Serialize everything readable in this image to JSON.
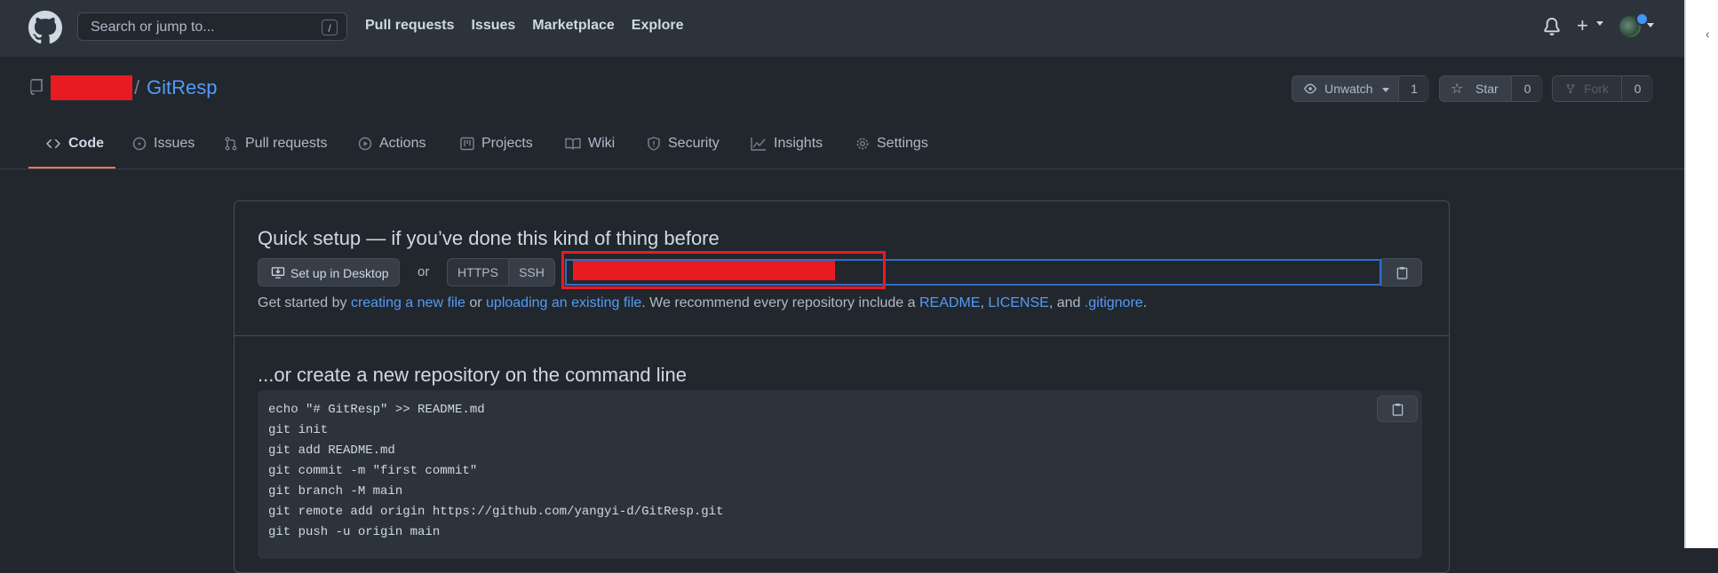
{
  "header": {
    "search_placeholder": "Search or jump to...",
    "search_shortcut": "/",
    "nav": [
      "Pull requests",
      "Issues",
      "Marketplace",
      "Explore"
    ]
  },
  "repo": {
    "separator": "/",
    "name": "GitResp",
    "watch_label": "Unwatch",
    "watch_count": "1",
    "star_label": "Star",
    "star_count": "0",
    "fork_label": "Fork",
    "fork_count": "0"
  },
  "tabs": [
    {
      "label": "Code",
      "icon": "code-icon",
      "active": true
    },
    {
      "label": "Issues",
      "icon": "issue-icon"
    },
    {
      "label": "Pull requests",
      "icon": "pull-request-icon"
    },
    {
      "label": "Actions",
      "icon": "play-icon"
    },
    {
      "label": "Projects",
      "icon": "project-icon"
    },
    {
      "label": "Wiki",
      "icon": "book-icon"
    },
    {
      "label": "Security",
      "icon": "shield-icon"
    },
    {
      "label": "Insights",
      "icon": "graph-icon"
    },
    {
      "label": "Settings",
      "icon": "gear-icon"
    }
  ],
  "quick_setup": {
    "title": "Quick setup — if you’ve done this kind of thing before",
    "desktop_button": "Set up in Desktop",
    "or": "or",
    "https": "HTTPS",
    "ssh": "SSH",
    "started_prefix": "Get started by ",
    "link_new_file": "creating a new file",
    "mid1": " or ",
    "link_upload": "uploading an existing file",
    "mid2": ". We recommend every repository include a ",
    "link_readme": "README",
    "comma": ", ",
    "link_license": "LICENSE",
    "and": ", and ",
    "link_gitignore": ".gitignore",
    "end": "."
  },
  "command_line": {
    "title": "...or create a new repository on the command line",
    "lines": [
      "echo \"# GitResp\" >> README.md",
      "git init",
      "git add README.md",
      "git commit -m \"first commit\"",
      "git branch -M main",
      "git remote add origin https://github.com/yangyi-d/GitResp.git",
      "git push -u origin main"
    ]
  },
  "colors": {
    "accent_link": "#539bf5",
    "redaction": "#e91b22",
    "tab_underline": "#ec775c"
  }
}
